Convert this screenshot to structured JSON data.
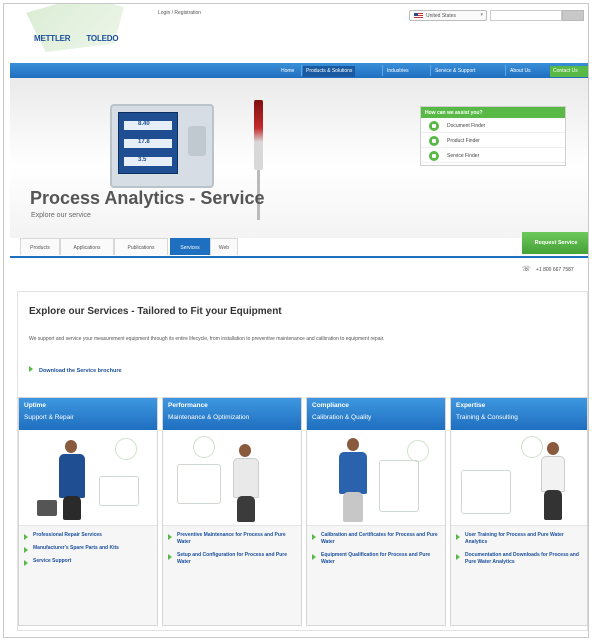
{
  "brand": {
    "name_left": "METTLER",
    "name_right": "TOLEDO"
  },
  "header": {
    "login": "Login / Registration",
    "country": "United States",
    "search_placeholder": ""
  },
  "nav": {
    "items": [
      "Home",
      "Products & Solutions",
      "Industries",
      "Service & Support",
      "About Us",
      "Contact Us"
    ]
  },
  "hero": {
    "title": "Process Analytics - Service",
    "subtitle": "Explore our service",
    "device_values": [
      "8.40",
      "17.8",
      "3.5"
    ],
    "assist": {
      "title": "How can we assist you?",
      "items": [
        "Document Finder",
        "Product Finder",
        "Service Finder"
      ]
    }
  },
  "tabs": [
    "Products",
    "Applications",
    "Publications",
    "Services",
    "Web"
  ],
  "active_tab": "Services",
  "request_service": "Request Service",
  "phone": "+1 800 667 7587",
  "explore": {
    "title": "Explore our Services - Tailored to Fit your Equipment",
    "description": "We support and service your measurement equipment through its entire lifecycle, from installation to preventive maintenance and calibration to equipment repair.",
    "download": "Download the Service brochure"
  },
  "cards": [
    {
      "h1": "Uptime",
      "h2": "Support & Repair",
      "links": [
        "Professional Repair Services",
        "Manufacturer's Spare Parts and Kits",
        "Service Support"
      ]
    },
    {
      "h1": "Performance",
      "h2": "Maintenance & Optimization",
      "links": [
        "Preventive Maintenance for Process and Pure Water",
        "Setup and Configuration for Process and Pure Water"
      ]
    },
    {
      "h1": "Compliance",
      "h2": "Calibration & Quality",
      "links": [
        "Calibration and Certificates for Process and Pure Water",
        "Equipment Qualification for Process and Pure Water"
      ]
    },
    {
      "h1": "Expertise",
      "h2": "Training & Consulting",
      "links": [
        "User Training for Process and Pure Water Analytics",
        "Documentation and Downloads for Process and Pure Water Analytics"
      ]
    }
  ],
  "colors": {
    "nav_blue": "#1f6fc0",
    "green": "#58b947",
    "brand_blue": "#1a4f9c"
  }
}
